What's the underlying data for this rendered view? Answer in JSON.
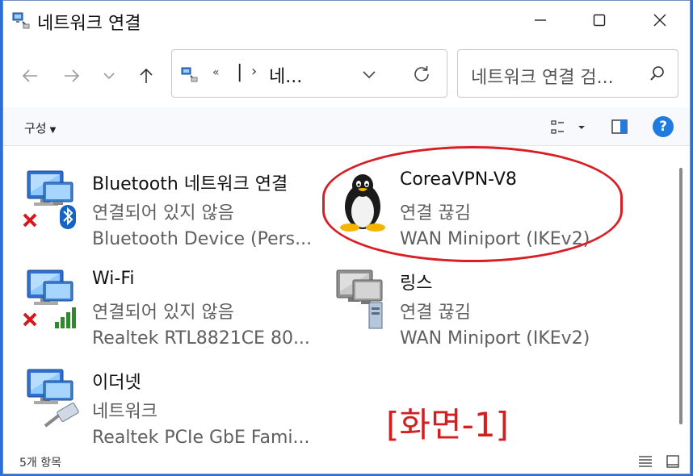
{
  "window": {
    "title": "네트워크 연결"
  },
  "address": {
    "chevron": "«",
    "separator": "|",
    "arrow": "›",
    "path_text": "네..."
  },
  "search": {
    "placeholder": "네트워크 연결 검..."
  },
  "command_bar": {
    "organize_label": "구성",
    "help_label": "?"
  },
  "items": [
    {
      "name": "Bluetooth 네트워크 연결",
      "status": "연결되어 있지 않음",
      "device": "Bluetooth Device (Pers..."
    },
    {
      "name": "CoreaVPN-V8",
      "status": "연결 끊김",
      "device": "WAN Miniport (IKEv2)"
    },
    {
      "name": "Wi-Fi",
      "status": "연결되어 있지 않음",
      "device": "Realtek RTL8821CE 80..."
    },
    {
      "name": "링스",
      "status": "연결 끊김",
      "device": "WAN Miniport (IKEv2)"
    },
    {
      "name": "이더넷",
      "status": "네트워크",
      "device": "Realtek PCIe GbE Fami..."
    }
  ],
  "annotation": {
    "label": "[화면-1]",
    "color": "#d22020"
  },
  "status_bar": {
    "count": "5개 항목"
  },
  "colors": {
    "accent": "#1f7be0",
    "error_x": "#d7191c",
    "signal": "#2d8a2d",
    "bluetooth": "#1565c0"
  }
}
